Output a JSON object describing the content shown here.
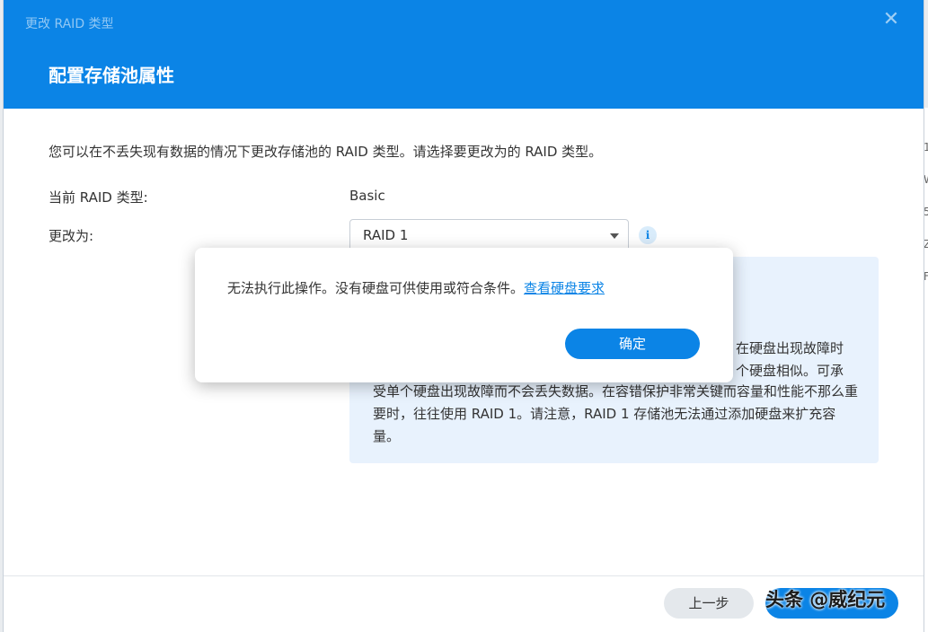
{
  "background": {
    "side_glyphs": [
      "1",
      "W",
      "5",
      "Z",
      "F"
    ]
  },
  "dialog": {
    "window_title": "更改 RAID 类型",
    "step_title": "配置存储池属性",
    "description": "您可以在不丢失现有数据的情况下更改存储池的 RAID 类型。请选择要更改为的 RAID 类型。",
    "current_label": "当前 RAID 类型:",
    "current_value": "Basic",
    "change_label": "更改为:",
    "select_value": "RAID 1",
    "info": {
      "fragment_1": "在硬盘出现故障时",
      "fragment_2": "个硬盘相似。可承",
      "text": "受单个硬盘出现故障而不会丢失数据。在容错保护非常关键而容量和性能不那么重要时，往往使用 RAID 1。请注意，RAID 1 存储池无法通过添加硬盘来扩充容量。"
    },
    "back_label": "上一步"
  },
  "modal": {
    "message": "无法执行此操作。没有硬盘可供使用或符合条件。",
    "link": "查看硬盘要求",
    "ok_label": "确定"
  },
  "watermark": "头条 @威纪元",
  "colors": {
    "accent": "#0b84e6",
    "info_bg": "#e8f2fd"
  },
  "icons": {
    "close": "close-icon",
    "info": "info-icon",
    "dropdown": "chevron-down-icon"
  }
}
